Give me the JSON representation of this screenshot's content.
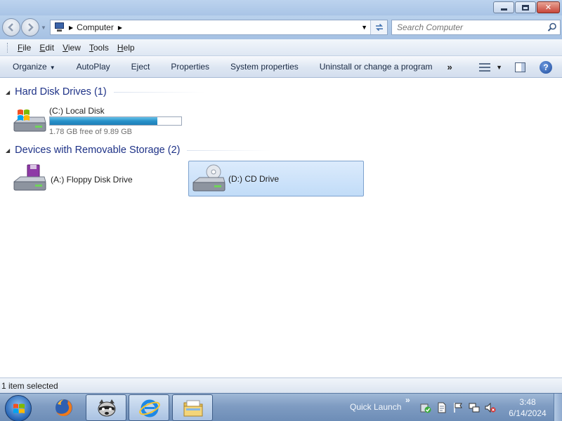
{
  "window": {
    "minimize_icon": "minimize-icon",
    "maximize_icon": "restore-icon",
    "close_icon": "close-icon",
    "close_label": "✕"
  },
  "nav": {
    "address_crumb": "Computer",
    "search_placeholder": "Search Computer"
  },
  "menu": {
    "items": [
      "File",
      "Edit",
      "View",
      "Tools",
      "Help"
    ]
  },
  "toolbar": {
    "organize": "Organize",
    "autoplay": "AutoPlay",
    "eject": "Eject",
    "properties": "Properties",
    "system_properties": "System properties",
    "uninstall": "Uninstall or change a program",
    "more": "»"
  },
  "groups": {
    "hard_disk": "Hard Disk Drives (1)",
    "removable": "Devices with Removable Storage (2)"
  },
  "drives": {
    "c": {
      "name": "(C:) Local Disk",
      "free_text": "1.78 GB free of 9.89 GB",
      "used_fraction": 0.82
    },
    "a": {
      "name": "(A:) Floppy Disk Drive"
    },
    "d": {
      "name": "(D:) CD Drive"
    }
  },
  "status": {
    "text": "1 item selected"
  },
  "taskbar": {
    "quick_launch": "Quick Launch",
    "ql_chevron": "»",
    "time": "3:48",
    "date": "6/14/2024"
  },
  "colors": {
    "group_title": "#1e3287",
    "selection_bg": "#c9e1fa",
    "progress_fill": "#2891c9"
  }
}
